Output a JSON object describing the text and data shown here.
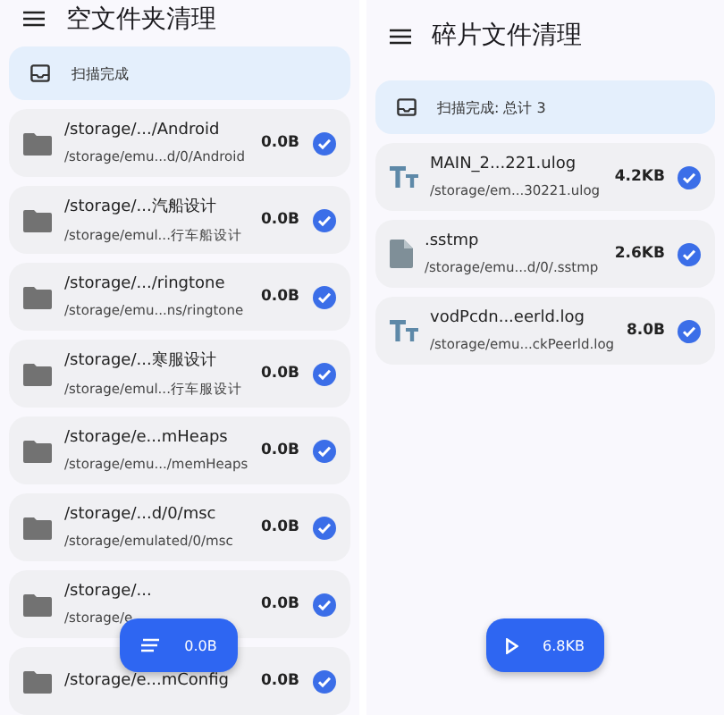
{
  "panels": [
    {
      "title": "空文件夹清理",
      "status": "扫描完成",
      "fab": {
        "kind": "sort",
        "label": "0.0B"
      },
      "items": [
        {
          "kind": "folder",
          "name": "/storage/.../Android",
          "path": "/storage/emu...d/0/Android",
          "size": "0.0B",
          "checked": true
        },
        {
          "kind": "folder",
          "name": "/storage/...汽船设计",
          "path": "/storage/emul...行车船设计",
          "size": "0.0B",
          "checked": true
        },
        {
          "kind": "folder",
          "name": "/storage/.../ringtone",
          "path": "/storage/emu...ns/ringtone",
          "size": "0.0B",
          "checked": true
        },
        {
          "kind": "folder",
          "name": "/storage/...寒服设计",
          "path": "/storage/emul...行车服设计",
          "size": "0.0B",
          "checked": true
        },
        {
          "kind": "folder",
          "name": "/storage/e...mHeaps",
          "path": "/storage/emu.../memHeaps",
          "size": "0.0B",
          "checked": true
        },
        {
          "kind": "folder",
          "name": "/storage/...d/0/msc",
          "path": "/storage/emulated/0/msc",
          "size": "0.0B",
          "checked": true
        },
        {
          "kind": "folder",
          "name": "/storage/...",
          "path": "/storage/e",
          "size": "0.0B",
          "checked": true
        },
        {
          "kind": "folder",
          "name": "/storage/e...mConfig",
          "size": "0.0B",
          "checked": true
        }
      ]
    },
    {
      "title": "碎片文件清理",
      "status": "扫描完成: 总计 3",
      "fab": {
        "kind": "play",
        "label": "6.8KB"
      },
      "items": [
        {
          "kind": "text",
          "name": "MAIN_2...221.ulog",
          "path": "/storage/em...30221.ulog",
          "size": "4.2KB",
          "checked": true
        },
        {
          "kind": "file",
          "name": ".sstmp",
          "path": "/storage/emu...d/0/.sstmp",
          "size": "2.6KB",
          "checked": true
        },
        {
          "kind": "text",
          "name": "vodPcdn...eerld.log",
          "path": "/storage/emu...ckPeerld.log",
          "size": "8.0B",
          "checked": true
        }
      ]
    }
  ]
}
